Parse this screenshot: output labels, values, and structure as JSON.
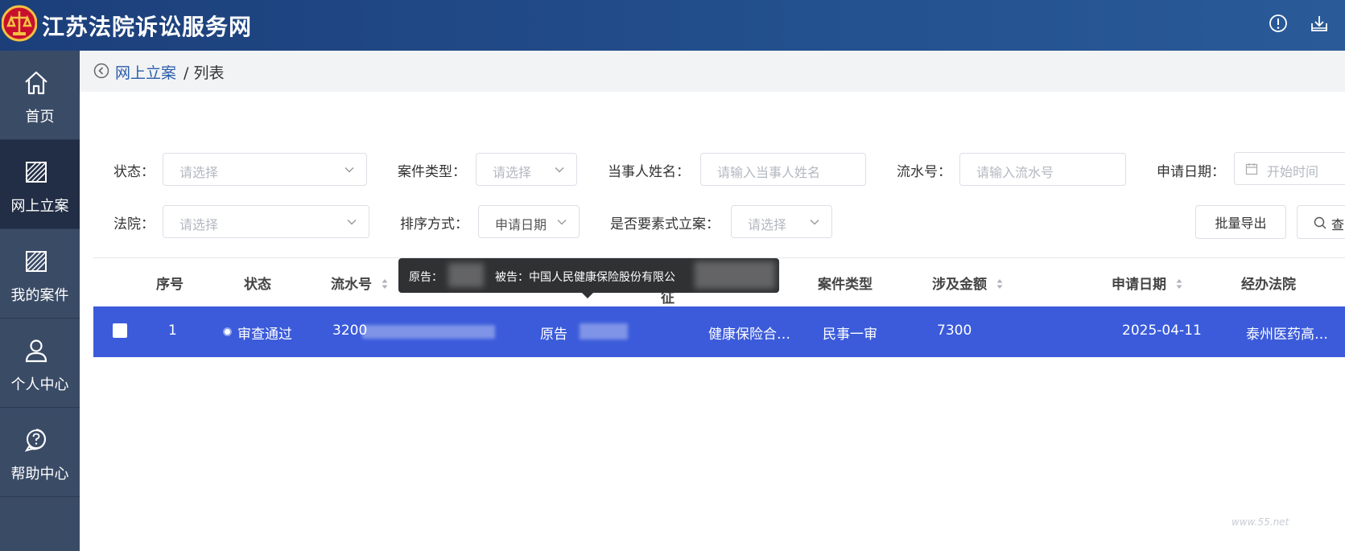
{
  "header": {
    "title": "江苏法院诉讼服务网",
    "icons": [
      "info-icon",
      "download-icon"
    ]
  },
  "sidebar": {
    "items": [
      {
        "label": "首页",
        "icon": "home-icon"
      },
      {
        "label": "网上立案",
        "icon": "case-filing-icon",
        "active": true
      },
      {
        "label": "我的案件",
        "icon": "my-cases-icon"
      },
      {
        "label": "个人中心",
        "icon": "user-icon"
      },
      {
        "label": "帮助中心",
        "icon": "help-icon"
      }
    ]
  },
  "breadcrumb": {
    "link": "网上立案",
    "current": "/ 列表"
  },
  "filters": {
    "status_label": "状态：",
    "status_placeholder": "请选择",
    "case_type_label": "案件类型：",
    "case_type_placeholder": "请选择",
    "party_name_label": "当事人姓名：",
    "party_name_placeholder": "请输入当事人姓名",
    "serial_label": "流水号：",
    "serial_placeholder": "请输入流水号",
    "apply_date_label": "申请日期：",
    "apply_date_placeholder": "开始时间",
    "court_label": "法院：",
    "court_placeholder": "请选择",
    "sort_label": "排序方式：",
    "sort_value": "申请日期",
    "element_label": "是否要素式立案：",
    "element_placeholder": "请选择",
    "export_button": "批量导出",
    "search_button": "查"
  },
  "table": {
    "columns": {
      "index": "序号",
      "status": "状态",
      "serial": "流水号",
      "reason_tail": "征",
      "case_type": "案件类型",
      "amount": "涉及金额",
      "apply_date": "申请日期",
      "court": "经办法院"
    },
    "rows": [
      {
        "index": "1",
        "status": "审查通过",
        "serial": "3200",
        "parties": "原告",
        "case_reason": "健康保险合…",
        "case_type": "民事一审",
        "amount": "7300",
        "apply_date": "2025-04-11",
        "court": "泰州医药高…"
      }
    ]
  },
  "tooltip": {
    "plaintiff": "原告：",
    "defendant": "被告：中国人民健康保险股份有限公"
  },
  "colors": {
    "header": "#23508e",
    "sidebar": "#3a4b66",
    "sidebar_active": "#222e45",
    "row_selected": "#3b5bdb",
    "link": "#2a5caa"
  }
}
